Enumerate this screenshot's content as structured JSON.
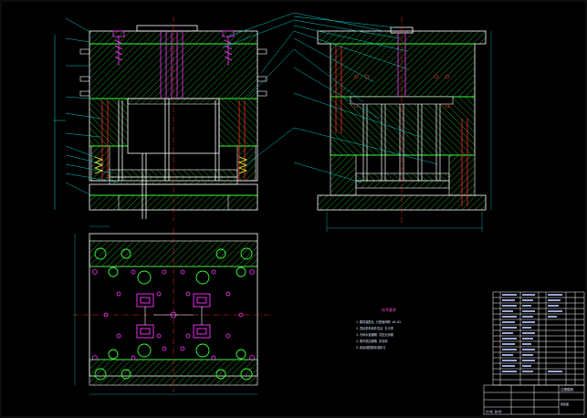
{
  "drawing": {
    "colors": {
      "background": "#000000",
      "outline": "#ffffff",
      "plate_edge": "#39ff39",
      "hatch": "#1f8f1f",
      "leader": "#00cccc",
      "centerline": "#ff2a2a",
      "pin": "#ff33ff",
      "screw": "#ff33ff",
      "spring": "#ffff33",
      "note_text": "#dfe6ff",
      "note_title": "#ff4fd8",
      "title_block": "#ffffff"
    },
    "icons": [
      "screw-icon",
      "guide-pin-icon",
      "spring-icon",
      "ejector-pin-icon"
    ]
  },
  "notes": {
    "title": "技术要求",
    "lines": [
      "1.模具装配后 分型面间隙 ≤0.02",
      "2.顶出机构动作灵活 无卡滞",
      "3.冷却水道通畅 试压无渗漏",
      "4.零件锐边倒角 去毛刺",
      "5.其余按国家标准执行"
    ]
  },
  "title_block": {
    "name": "注塑模具",
    "subtitle": "装配图",
    "sheet": "共1张 第1张"
  }
}
